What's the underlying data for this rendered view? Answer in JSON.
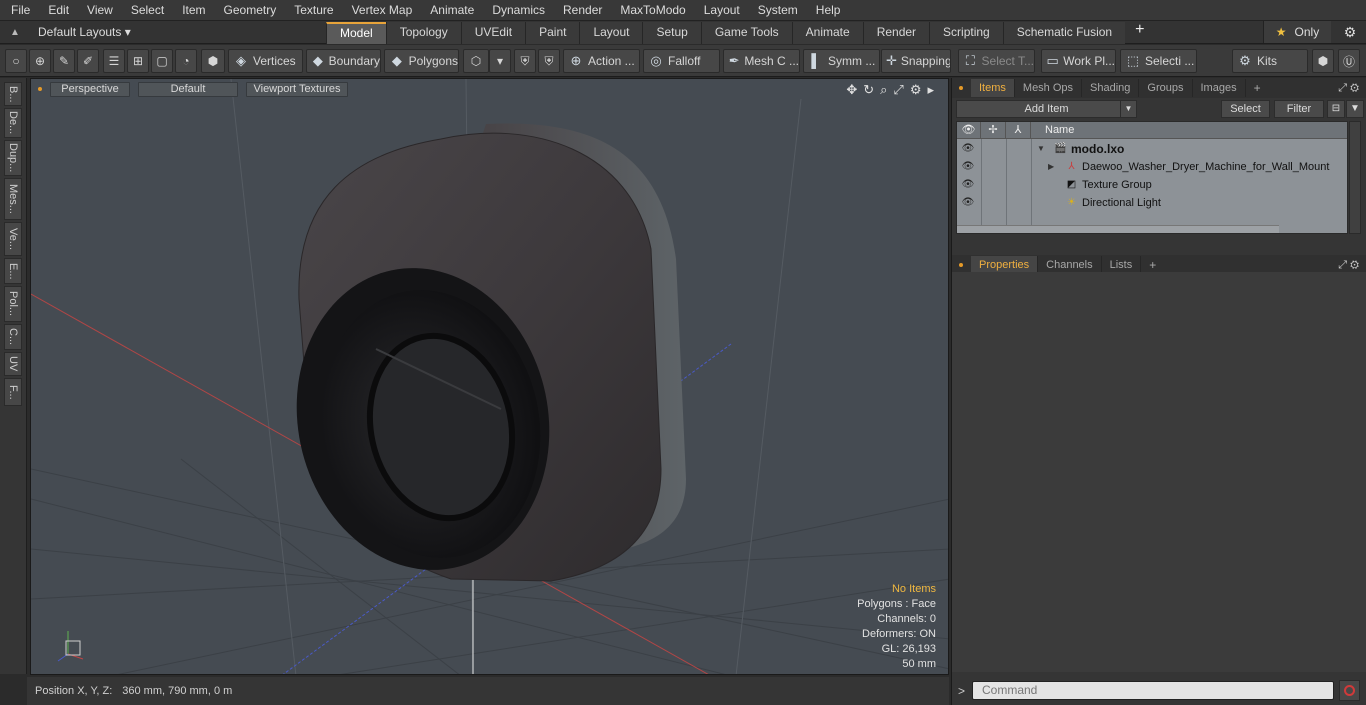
{
  "menu": [
    "File",
    "Edit",
    "View",
    "Select",
    "Item",
    "Geometry",
    "Texture",
    "Vertex Map",
    "Animate",
    "Dynamics",
    "Render",
    "MaxToModo",
    "Layout",
    "System",
    "Help"
  ],
  "layouts": {
    "label": "Default Layouts ▾"
  },
  "layout_tabs": [
    "Model",
    "Topology",
    "UVEdit",
    "Paint",
    "Layout",
    "Setup",
    "Game Tools",
    "Animate",
    "Render",
    "Scripting",
    "Schematic Fusion"
  ],
  "active_layout_tab": "Model",
  "only_label": "Only",
  "toolbar": {
    "vertices": "Vertices",
    "boundary": "Boundary",
    "polygons": "Polygons",
    "action": "Action ...",
    "falloff": "Falloff",
    "mesh": "Mesh C ...",
    "symm": "Symm ...",
    "snapping": "Snapping",
    "select_t": "Select T...",
    "work_pl": "Work Pl...",
    "selecti": "Selecti ...",
    "kits": "Kits"
  },
  "left_tabs": [
    "B...",
    "De...",
    "Dup...",
    "Mes...",
    "Ve...",
    "E...",
    "Pol...",
    "C...",
    "UV",
    "F..."
  ],
  "viewport": {
    "perspective": "Perspective",
    "default": "Default",
    "textures": "Viewport Textures",
    "stats": {
      "no_items": "No Items",
      "polygons": "Polygons : Face",
      "channels": "Channels: 0",
      "deformers": "Deformers: ON",
      "gl": "GL: 26,193",
      "scale": "50 mm"
    }
  },
  "status": {
    "label": "Position X, Y, Z:",
    "value": "360 mm, 790 mm, 0 m"
  },
  "items_panel": {
    "tabs": [
      "Items",
      "Mesh Ops",
      "Shading",
      "Groups",
      "Images"
    ],
    "active": "Items",
    "add_item": "Add Item",
    "select": "Select",
    "filter": "Filter",
    "name_col": "Name",
    "rows": [
      {
        "name": "modo.lxo",
        "icon": "scene-icon",
        "bold": true
      },
      {
        "name": "Daewoo_Washer_Dryer_Machine_for_Wall_Mount",
        "icon": "mesh-icon"
      },
      {
        "name": "Texture Group",
        "icon": "texture-group-icon"
      },
      {
        "name": "Directional Light",
        "icon": "light-icon"
      }
    ]
  },
  "props_panel": {
    "tabs": [
      "Properties",
      "Channels",
      "Lists"
    ],
    "active": "Properties"
  },
  "command": {
    "placeholder": "Command"
  },
  "colors": {
    "accent": "#e8a43a",
    "viewport_bg": "#454b52",
    "machine": "#3a3638"
  }
}
